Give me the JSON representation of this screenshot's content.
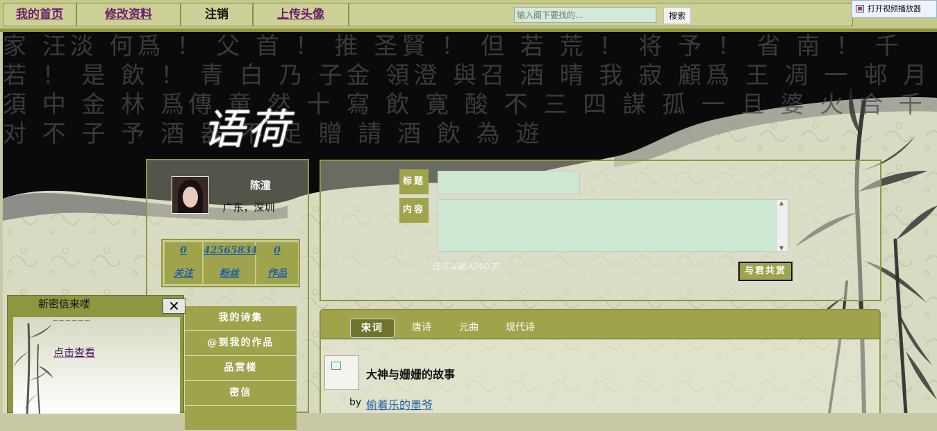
{
  "nav": {
    "home": "我的首页",
    "edit_profile": "修改资料",
    "logout": "注销",
    "upload_avatar": "上传头像",
    "search_placeholder": "输入阁下要找的...",
    "search_button": "搜索"
  },
  "video_popup": "打开视频播放器",
  "banner": {
    "logo": "语荷",
    "seal_text": "家 汪淡 何爲 ！ 父 首 ！ 推 圣賢 ！ 但 若 荒 ！ 将 予 ！ 省 南 ！ 千 若 ！ 是 飲 ！ 青 白 乃 子金 領澄 與召 酒 晴 我 寂 顧爲 王 凋 一 邨 月 須 中 金 林 爲傳 童 然 十 寫 飲 寛 酸 不 三 四 謀 孤 一 且 婆 火 合 千 对 不 子 予 酒 器 不 足 贈 請 酒 飲 為 遊"
  },
  "profile": {
    "name": "陈潼",
    "location": "广东，深圳",
    "stats": [
      {
        "value": "0",
        "label": "关注"
      },
      {
        "value": "42565834",
        "label": "粉丝"
      },
      {
        "value": "0",
        "label": "作品"
      }
    ]
  },
  "menu": [
    "我的诗集",
    "@到我的作品",
    "品赏楼",
    "密信",
    ""
  ],
  "message_popup": {
    "title": "新密信来喽",
    "close": "✕",
    "wave": "~~~~~~",
    "link": "点击查看"
  },
  "post": {
    "title_label": "标题",
    "content_label": "内容",
    "hint": "还可以输入200字",
    "submit": "与君共赏"
  },
  "tabs": [
    "宋词",
    "唐诗",
    "元曲",
    "现代诗"
  ],
  "article": {
    "title": "大神与姗姗的故事",
    "by": "by",
    "author": "偷着乐的墨爷"
  },
  "colors": {
    "olive": "#9fa44c",
    "olive_dark": "#8f9640",
    "nav_bg": "#c5c98a",
    "input_bg": "#cde8d2",
    "link": "#1f5ea8"
  }
}
